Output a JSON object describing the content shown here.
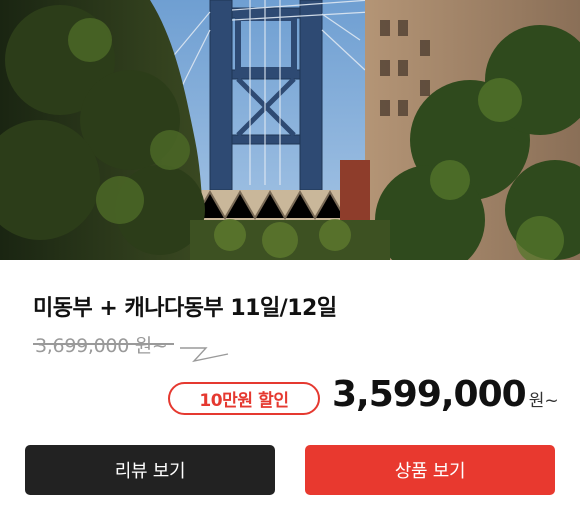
{
  "product": {
    "title": "미동부 + 캐나다동부 11일/12일",
    "original_price": "3,699,000 원~",
    "discount_badge": "10만원 할인",
    "sale_price": "3,599,000",
    "sale_price_unit": "원~"
  },
  "buttons": {
    "review_label": "리뷰 보기",
    "product_label": "상품 보기"
  },
  "colors": {
    "accent_red": "#e8392f",
    "dark_button": "#222222",
    "muted_text": "#9a9a9a"
  },
  "image": {
    "subject": "manhattan-bridge-photo"
  }
}
